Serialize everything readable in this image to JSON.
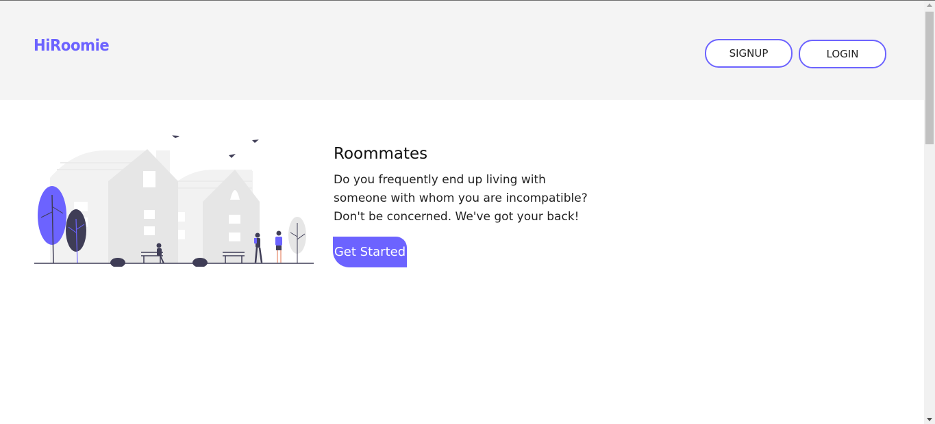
{
  "header": {
    "logo": "HiRoomie",
    "signup_label": "SIGNUP",
    "login_label": "LOGIN"
  },
  "hero": {
    "title": "Roommates",
    "text": "Do you frequently end up living with someone with whom you are incompatible? Don't be concerned. We've got your back!",
    "cta_label": "Get Started",
    "illustration_icon": "city-park-illustration"
  },
  "colors": {
    "accent": "#6c63ff",
    "header_bg": "#f4f4f4",
    "building": "#e6e6e6",
    "dark": "#3f3d56"
  }
}
